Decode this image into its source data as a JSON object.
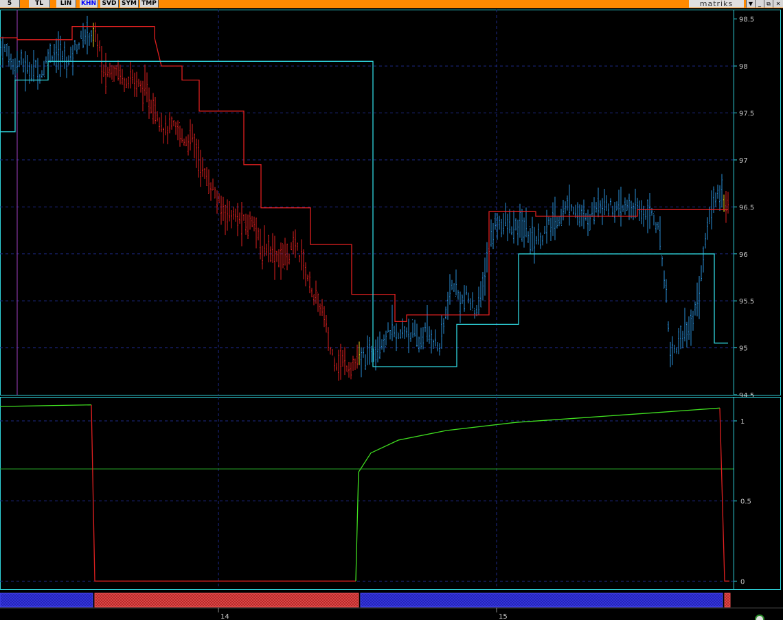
{
  "toolbar": {
    "buttons": [
      "5",
      "TL",
      "LIN",
      "KHN",
      "SVD",
      "SYM",
      "TMP"
    ],
    "active": "KHN",
    "brand": "matriks",
    "window_controls": [
      "▼",
      "_",
      "⧉",
      "✕"
    ]
  },
  "colors": {
    "toolbar": "#ff8a00",
    "bull": "#2a8fd8",
    "bear": "#e02020",
    "stop": "#e02020",
    "envelope": "#30d8e0",
    "oscillator_up": "#40e020",
    "oscillator_down": "#e02020",
    "grid": "#1e2a8a",
    "frame": "#30d8e0",
    "signal_bull": "#2020b0",
    "signal_bear": "#b02020"
  },
  "chart_data": [
    {
      "type": "ohlc",
      "y_axis_ticks": [
        "98.5",
        "98",
        "97.5",
        "97",
        "96.5",
        "96",
        "95.5",
        "95",
        "94.5"
      ],
      "ylim": [
        94.5,
        98.6
      ],
      "x_axis_ticks": [
        "14",
        "15"
      ],
      "price_path": [
        [
          0,
          98.2
        ],
        [
          10,
          98.15
        ],
        [
          20,
          98.0
        ],
        [
          30,
          98.05
        ],
        [
          40,
          97.95
        ],
        [
          50,
          98.0
        ],
        [
          60,
          97.9
        ],
        [
          70,
          98.1
        ],
        [
          80,
          98.15
        ],
        [
          90,
          98.1
        ],
        [
          100,
          98.05
        ],
        [
          110,
          98.2
        ],
        [
          120,
          98.3
        ],
        [
          130,
          98.35
        ],
        [
          140,
          98.3
        ],
        [
          145,
          98.2
        ],
        [
          150,
          97.9
        ],
        [
          160,
          97.95
        ],
        [
          170,
          98.0
        ],
        [
          180,
          97.85
        ],
        [
          190,
          97.9
        ],
        [
          200,
          97.8
        ],
        [
          210,
          97.75
        ],
        [
          220,
          97.6
        ],
        [
          230,
          97.5
        ],
        [
          240,
          97.3
        ],
        [
          250,
          97.35
        ],
        [
          260,
          97.3
        ],
        [
          270,
          97.2
        ],
        [
          280,
          97.25
        ],
        [
          290,
          97.0
        ],
        [
          300,
          96.8
        ],
        [
          310,
          96.7
        ],
        [
          320,
          96.5
        ],
        [
          330,
          96.45
        ],
        [
          340,
          96.4
        ],
        [
          350,
          96.35
        ],
        [
          360,
          96.3
        ],
        [
          370,
          96.4
        ],
        [
          380,
          96.0
        ],
        [
          390,
          96.1
        ],
        [
          400,
          96.0
        ],
        [
          410,
          95.95
        ],
        [
          420,
          96.0
        ],
        [
          430,
          96.1
        ],
        [
          440,
          95.95
        ],
        [
          450,
          95.7
        ],
        [
          460,
          95.5
        ],
        [
          470,
          95.4
        ],
        [
          480,
          95.0
        ],
        [
          490,
          94.85
        ],
        [
          500,
          94.85
        ],
        [
          510,
          94.8
        ],
        [
          520,
          94.85
        ],
        [
          530,
          94.9
        ],
        [
          540,
          94.95
        ],
        [
          550,
          95.05
        ],
        [
          560,
          95.1
        ],
        [
          570,
          95.2
        ],
        [
          580,
          95.1
        ],
        [
          590,
          95.2
        ],
        [
          600,
          95.15
        ],
        [
          610,
          95.05
        ],
        [
          620,
          95.2
        ],
        [
          630,
          95.1
        ],
        [
          640,
          95.0
        ],
        [
          650,
          95.4
        ],
        [
          660,
          95.7
        ],
        [
          670,
          95.5
        ],
        [
          680,
          95.55
        ],
        [
          690,
          95.4
        ],
        [
          700,
          95.5
        ],
        [
          710,
          96.0
        ],
        [
          720,
          96.3
        ],
        [
          730,
          96.35
        ],
        [
          740,
          96.3
        ],
        [
          750,
          96.25
        ],
        [
          760,
          96.3
        ],
        [
          770,
          96.2
        ],
        [
          780,
          96.15
        ],
        [
          790,
          96.2
        ],
        [
          800,
          96.3
        ],
        [
          810,
          96.35
        ],
        [
          820,
          96.45
        ],
        [
          830,
          96.55
        ],
        [
          840,
          96.45
        ],
        [
          850,
          96.35
        ],
        [
          860,
          96.4
        ],
        [
          870,
          96.55
        ],
        [
          880,
          96.55
        ],
        [
          890,
          96.5
        ],
        [
          900,
          96.45
        ],
        [
          910,
          96.5
        ],
        [
          920,
          96.5
        ],
        [
          930,
          96.45
        ],
        [
          940,
          96.45
        ],
        [
          950,
          96.45
        ],
        [
          960,
          96.2
        ],
        [
          970,
          95.6
        ],
        [
          975,
          95.0
        ],
        [
          980,
          94.95
        ],
        [
          990,
          95.1
        ],
        [
          1000,
          95.2
        ],
        [
          1010,
          95.3
        ],
        [
          1020,
          95.7
        ],
        [
          1030,
          96.3
        ],
        [
          1040,
          96.6
        ],
        [
          1050,
          96.7
        ],
        [
          1055,
          96.5
        ],
        [
          1060,
          96.5
        ]
      ],
      "series": [
        {
          "name": "",
          "color": "#e02020",
          "step_points": [
            [
              0,
              98.3
            ],
            [
              25,
              98.3
            ],
            [
              25,
              98.28
            ],
            [
              105,
              98.28
            ],
            [
              105,
              98.42
            ],
            [
              225,
              98.42
            ],
            [
              225,
              98.3
            ],
            [
              235,
              98.0
            ],
            [
              265,
              98.0
            ],
            [
              265,
              97.85
            ],
            [
              290,
              97.85
            ],
            [
              290,
              97.52
            ],
            [
              355,
              97.52
            ],
            [
              355,
              96.95
            ],
            [
              380,
              96.95
            ],
            [
              380,
              96.49
            ],
            [
              452,
              96.49
            ],
            [
              452,
              96.1
            ],
            [
              512,
              96.1
            ],
            [
              512,
              95.57
            ],
            [
              575,
              95.57
            ],
            [
              575,
              95.28
            ],
            [
              592,
              95.28
            ],
            [
              592,
              95.35
            ],
            [
              712,
              95.35
            ],
            [
              712,
              96.45
            ],
            [
              780,
              96.45
            ],
            [
              780,
              96.4
            ],
            [
              928,
              96.4
            ],
            [
              928,
              96.47
            ],
            [
              1060,
              96.47
            ]
          ]
        },
        {
          "name": "",
          "color": "#30d8e0",
          "step_points": [
            [
              0,
              97.3
            ],
            [
              22,
              97.3
            ],
            [
              22,
              97.85
            ],
            [
              70,
              97.85
            ],
            [
              70,
              98.05
            ],
            [
              543,
              98.05
            ],
            [
              543,
              94.8
            ],
            [
              665,
              94.8
            ],
            [
              665,
              95.25
            ],
            [
              755,
              95.25
            ],
            [
              755,
              96.0
            ],
            [
              1040,
              96.0
            ],
            [
              1040,
              95.05
            ],
            [
              1060,
              95.05
            ]
          ]
        }
      ]
    },
    {
      "type": "line",
      "y_axis_ticks": [
        "1",
        "0.5",
        "0"
      ],
      "ylim": [
        -0.05,
        1.15
      ],
      "reference_line": 0.7,
      "series": [
        {
          "name": "",
          "segments": [
            {
              "color": "#40e020",
              "points": [
                [
                  0,
                  1.09
                ],
                [
                  133,
                  1.1
                ]
              ]
            },
            {
              "color": "#e02020",
              "points": [
                [
                  133,
                  1.1
                ],
                [
                  138,
                  0.0
                ],
                [
                  518,
                  0.0
                ]
              ]
            },
            {
              "color": "#40e020",
              "points": [
                [
                  518,
                  0.0
                ],
                [
                  522,
                  0.68
                ],
                [
                  540,
                  0.8
                ],
                [
                  580,
                  0.88
                ],
                [
                  650,
                  0.94
                ],
                [
                  750,
                  0.99
                ],
                [
                  850,
                  1.02
                ],
                [
                  950,
                  1.05
                ],
                [
                  1048,
                  1.08
                ]
              ]
            },
            {
              "color": "#e02020",
              "points": [
                [
                  1048,
                  1.08
                ],
                [
                  1055,
                  0.0
                ],
                [
                  1062,
                  0.0
                ]
              ]
            }
          ]
        }
      ]
    },
    {
      "type": "signal_bar",
      "segments": [
        {
          "state": "bull",
          "from": 0,
          "to": 135
        },
        {
          "state": "bear",
          "from": 138,
          "to": 522
        },
        {
          "state": "bull",
          "from": 525,
          "to": 1052
        },
        {
          "state": "bear",
          "from": 1055,
          "to": 1063
        }
      ]
    }
  ]
}
